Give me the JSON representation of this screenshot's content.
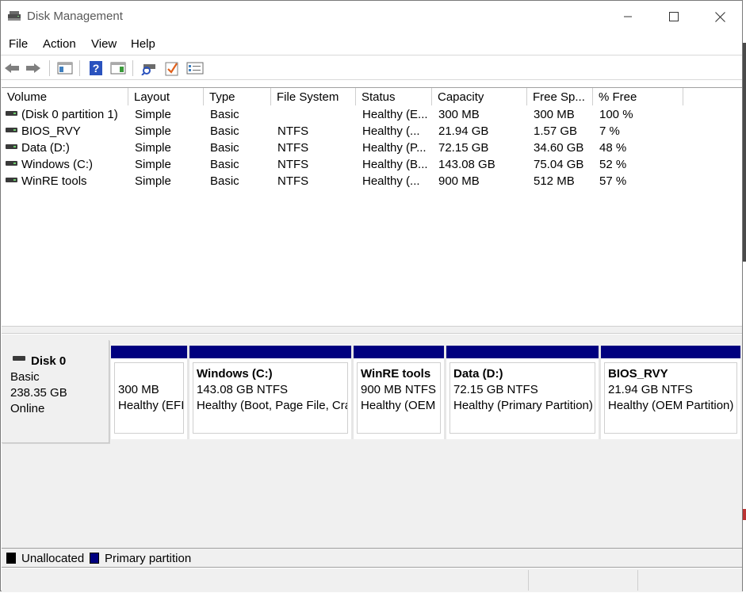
{
  "window": {
    "title": "Disk Management"
  },
  "menu": [
    "File",
    "Action",
    "View",
    "Help"
  ],
  "toolbar": {
    "buttons": [
      "back-icon",
      "forward-icon",
      "console-tree-icon",
      "help-icon",
      "show-pane-icon",
      "rescan-icon",
      "check-icon",
      "properties-icon"
    ]
  },
  "columns": [
    "Volume",
    "Layout",
    "Type",
    "File System",
    "Status",
    "Capacity",
    "Free Sp...",
    "% Free"
  ],
  "volumes": [
    {
      "volume": "(Disk 0 partition 1)",
      "layout": "Simple",
      "type": "Basic",
      "fs": "",
      "status": "Healthy (E...",
      "capacity": "300 MB",
      "free": "300 MB",
      "pct": "100 %"
    },
    {
      "volume": "BIOS_RVY",
      "layout": "Simple",
      "type": "Basic",
      "fs": "NTFS",
      "status": "Healthy (...",
      "capacity": "21.94 GB",
      "free": "1.57 GB",
      "pct": "7 %"
    },
    {
      "volume": "Data (D:)",
      "layout": "Simple",
      "type": "Basic",
      "fs": "NTFS",
      "status": "Healthy (P...",
      "capacity": "72.15 GB",
      "free": "34.60 GB",
      "pct": "48 %"
    },
    {
      "volume": "Windows (C:)",
      "layout": "Simple",
      "type": "Basic",
      "fs": "NTFS",
      "status": "Healthy (B...",
      "capacity": "143.08 GB",
      "free": "75.04 GB",
      "pct": "52 %"
    },
    {
      "volume": "WinRE tools",
      "layout": "Simple",
      "type": "Basic",
      "fs": "NTFS",
      "status": "Healthy (...",
      "capacity": "900 MB",
      "free": "512 MB",
      "pct": "57 %"
    }
  ],
  "disk": {
    "name": "Disk 0",
    "type": "Basic",
    "size": "238.35 GB",
    "state": "Online",
    "partitions": [
      {
        "name": "",
        "size": "300 MB",
        "status": "Healthy (EFI"
      },
      {
        "name": "Windows  (C:)",
        "size": "143.08 GB NTFS",
        "status": "Healthy (Boot, Page File, Cra"
      },
      {
        "name": "WinRE tools",
        "size": "900 MB NTFS",
        "status": "Healthy (OEM"
      },
      {
        "name": "Data  (D:)",
        "size": "72.15 GB NTFS",
        "status": "Healthy (Primary Partition)"
      },
      {
        "name": "BIOS_RVY",
        "size": "21.94 GB NTFS",
        "status": "Healthy (OEM Partition)"
      }
    ]
  },
  "legend": [
    {
      "label": "Unallocated",
      "color": "#000000"
    },
    {
      "label": "Primary partition",
      "color": "#00007f"
    }
  ],
  "colors": {
    "primary_partition": "#00007f",
    "unallocated": "#000000"
  }
}
